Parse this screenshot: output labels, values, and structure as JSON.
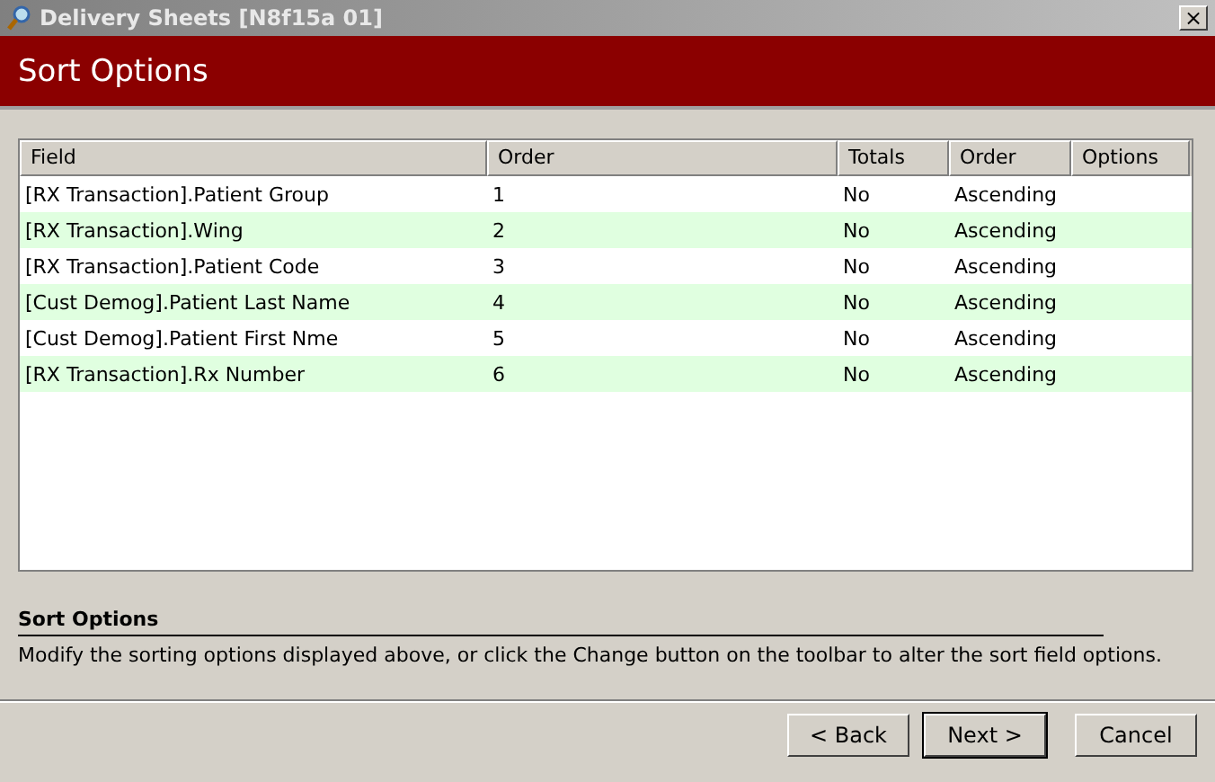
{
  "window": {
    "title": "Delivery Sheets [N8f15a 01]",
    "close": "×"
  },
  "header": {
    "title": "Sort Options"
  },
  "table": {
    "columns": [
      "Field",
      "Order",
      "Totals",
      "Order",
      "Options"
    ],
    "rows": [
      {
        "field": "[RX Transaction].Patient Group",
        "order": "1",
        "totals": "No",
        "direction": "Ascending"
      },
      {
        "field": "[RX Transaction].Wing",
        "order": "2",
        "totals": "No",
        "direction": "Ascending"
      },
      {
        "field": "[RX Transaction].Patient Code",
        "order": "3",
        "totals": "No",
        "direction": "Ascending"
      },
      {
        "field": "[Cust Demog].Patient Last Name",
        "order": "4",
        "totals": "No",
        "direction": "Ascending"
      },
      {
        "field": "[Cust Demog].Patient First Nme",
        "order": "5",
        "totals": "No",
        "direction": "Ascending"
      },
      {
        "field": "[RX Transaction].Rx Number",
        "order": "6",
        "totals": "No",
        "direction": "Ascending"
      }
    ]
  },
  "help": {
    "title": "Sort Options",
    "text": "Modify the sorting options displayed above, or click the Change button on the toolbar to alter the sort field options."
  },
  "buttons": [
    {
      "label": "< Back",
      "default": false
    },
    {
      "label": "Next >",
      "default": true
    },
    {
      "label": "Cancel",
      "default": false
    }
  ]
}
